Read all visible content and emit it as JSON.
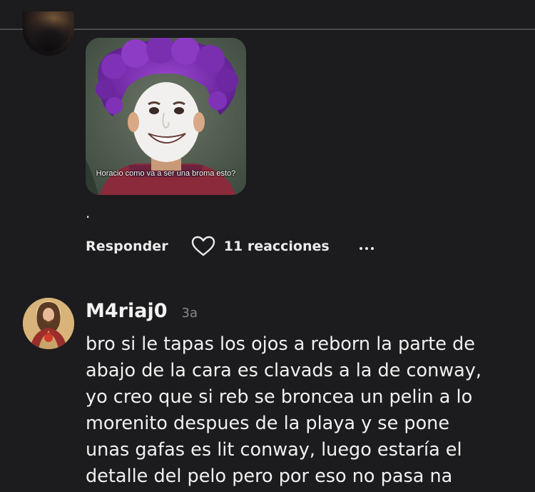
{
  "previous_comment": {
    "avatar_icon": "user-avatar-icon",
    "media": {
      "caption": "Horacio como va a ser una broma\nesto?"
    },
    "text": ".",
    "actions": {
      "reply_label": "Responder",
      "reactions_label": "11 reacciones",
      "heart_icon": "heart-icon",
      "more_icon": "more-options-icon"
    }
  },
  "comment": {
    "username": "M4riaj0",
    "timestamp": "3a",
    "avatar_icon": "sacred-heart-avatar-icon",
    "text": "bro si le tapas los ojos a reborn la parte de\nabajo de la cara es clavads a la de conway,\nyo creo que si reb se broncea un pelin a lo\nmorenito despues de la playa y se pone\nunas gafas es lit conway, luego estaría el\ndetalle del pelo pero por eso no pasa na"
  },
  "colors": {
    "background": "#1c1b1d",
    "divider": "#4a494c",
    "text_primary": "#f3f3f3",
    "text_muted": "#8a898c",
    "wig_purple": "#7a2fb0"
  }
}
